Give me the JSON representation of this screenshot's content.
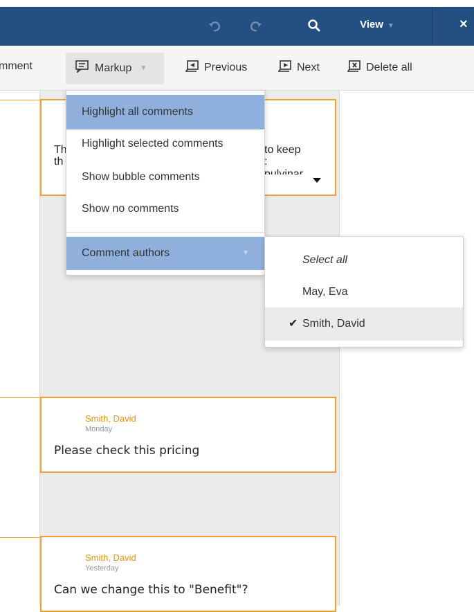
{
  "topbar": {
    "view_label": "View",
    "close_label": "×",
    "bg_color": "#245081"
  },
  "toolbar": {
    "comment_label": "mment",
    "markup_label": "Markup",
    "previous_label": "Previous",
    "next_label": "Next",
    "delete_all_label": "Delete all"
  },
  "first_card": {
    "frag1": "Th",
    "frag2": "th",
    "frag3": "to keep",
    "frag4": ":",
    "frag5": "pulvinar"
  },
  "comments": [
    {
      "author": "Smith, David",
      "time": "Monday",
      "text": "Please check this pricing"
    },
    {
      "author": "Smith, David",
      "time": "Yesterday",
      "text": "Can we change this to \"Benefit\"?"
    }
  ],
  "markup_menu": {
    "items": [
      "Highlight all comments",
      "Highlight selected comments",
      "Show bubble comments",
      "Show no comments"
    ],
    "authors_label": "Comment authors",
    "highlight_color": "#8fb0dd"
  },
  "authors_menu": {
    "select_all": "Select all",
    "authors": [
      {
        "name": "May, Eva",
        "checked": false
      },
      {
        "name": "Smith, David",
        "checked": true
      }
    ],
    "check_glyph": "✔"
  }
}
